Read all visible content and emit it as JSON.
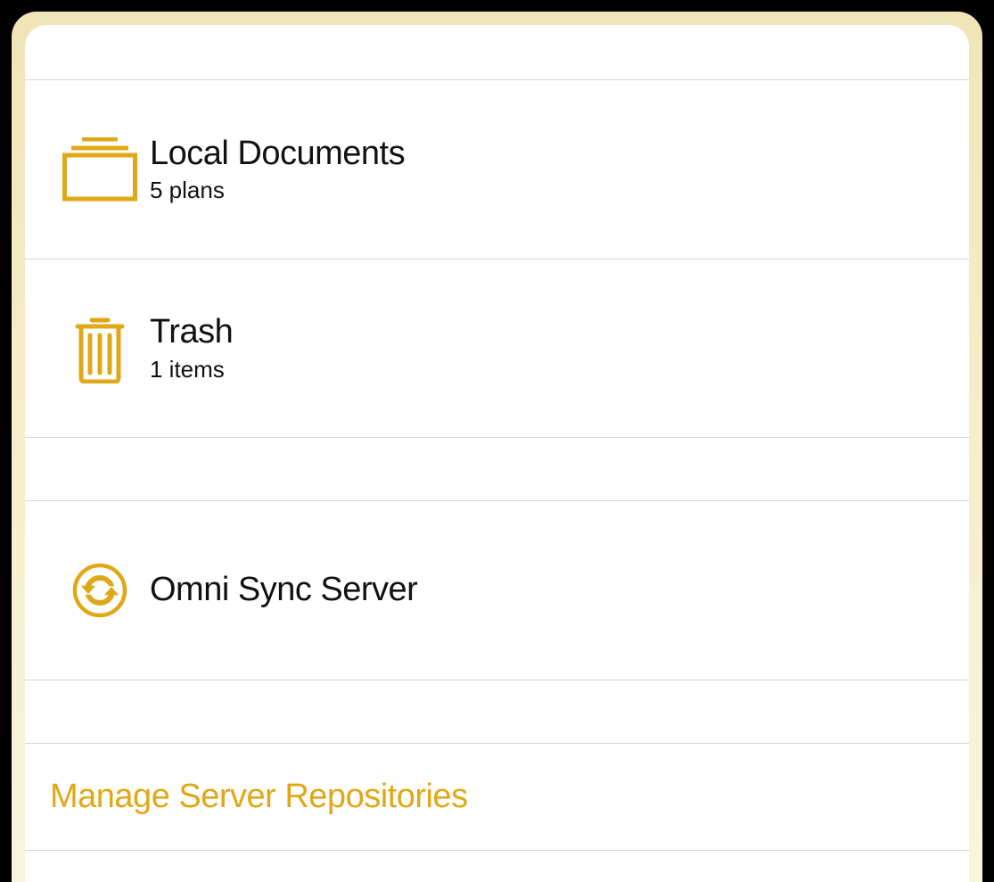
{
  "colors": {
    "accent": "#e0a817"
  },
  "list": {
    "local": {
      "title": "Local Documents",
      "subtitle": "5 plans"
    },
    "trash": {
      "title": "Trash",
      "subtitle": "1 items"
    },
    "sync": {
      "title": "Omni Sync Server"
    }
  },
  "manage_link": "Manage Server Repositories"
}
